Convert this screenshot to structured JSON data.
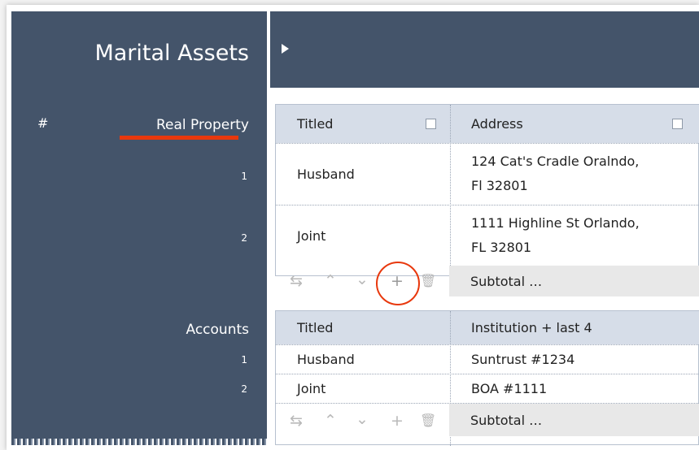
{
  "sidebar": {
    "title": "Marital Assets",
    "hash": "#",
    "sections": [
      {
        "label": "Real Property",
        "rows": [
          "1",
          "2"
        ]
      },
      {
        "label": "Accounts",
        "rows": [
          "1",
          "2"
        ]
      }
    ]
  },
  "real_property": {
    "headers": [
      "Titled",
      "Address"
    ],
    "rows": [
      {
        "titled": "Husband",
        "address_line1": "124 Cat's Cradle Oralndo,",
        "address_line2": "Fl 32801"
      },
      {
        "titled": "Joint",
        "address_line1": "1111 Highline St Orlando,",
        "address_line2": "FL 32801"
      }
    ],
    "subtotal": "Subtotal …"
  },
  "accounts": {
    "headers": [
      "Titled",
      "Institution + last 4"
    ],
    "rows": [
      {
        "titled": "Husband",
        "institution": "Suntrust #1234"
      },
      {
        "titled": "Joint",
        "institution": "BOA #1111"
      }
    ],
    "subtotal": "Subtotal …"
  },
  "icons": [
    "swap-icon",
    "chevron-up-icon",
    "chevron-down-icon",
    "plus-icon",
    "trash-icon"
  ],
  "colors": {
    "header_bg": "#44546a",
    "accent": "#e8380d",
    "grid_header": "#d6dde8"
  }
}
